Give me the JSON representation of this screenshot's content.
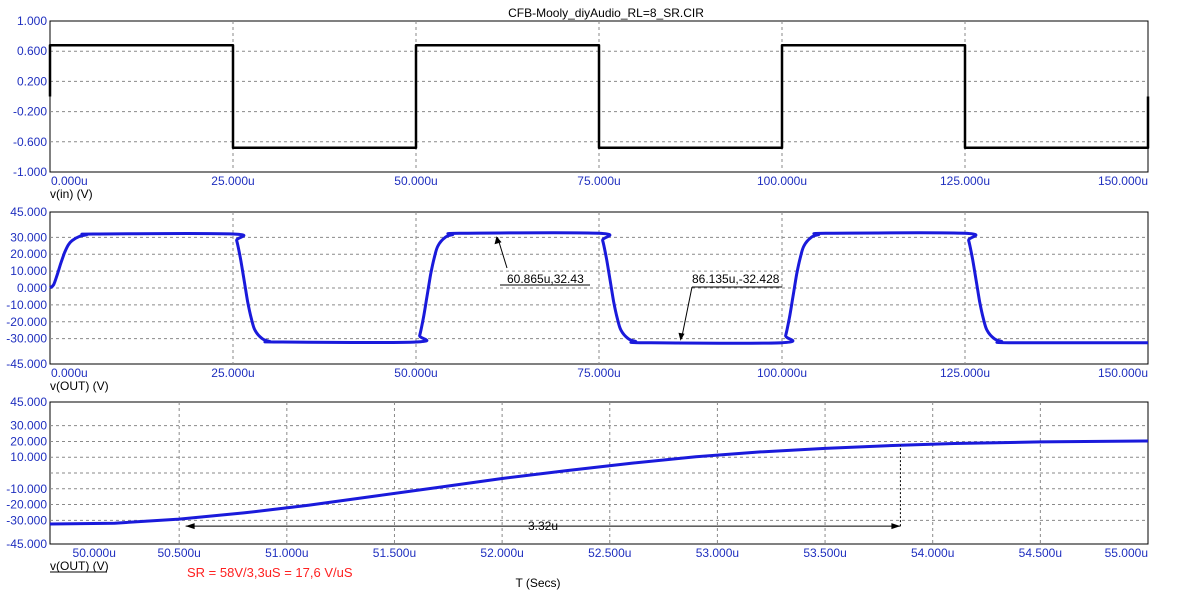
{
  "title": "CFB-Mooly_diyAudio_RL=8_SR.CIR",
  "x_axis_label": "T (Secs)",
  "colors": {
    "axis_text": "#1f2fbf",
    "trace_in": "#000000",
    "trace_out": "#1a1adb",
    "grid": "#8a8a8a",
    "annotation": "#ff2020"
  },
  "chart_data": [
    {
      "type": "line",
      "trace_label": "v(in) (V)",
      "xlim": [
        0,
        150
      ],
      "ylim": [
        -1,
        1
      ],
      "x_ticks": [
        "0.000u",
        "25.000u",
        "50.000u",
        "75.000u",
        "100.000u",
        "125.000u",
        "150.000u"
      ],
      "y_ticks": [
        "1.000",
        "0.600",
        "0.200",
        "-0.200",
        "-0.600",
        "-1.000"
      ],
      "series": [
        {
          "color": "#000000",
          "x": [
            0,
            0,
            25,
            25,
            50,
            50,
            75,
            75,
            100,
            100,
            125,
            125,
            150,
            150
          ],
          "y": [
            0,
            0.68,
            0.68,
            -0.68,
            -0.68,
            0.68,
            0.68,
            -0.68,
            -0.68,
            0.68,
            0.68,
            -0.68,
            -0.68,
            0
          ]
        }
      ]
    },
    {
      "type": "line",
      "trace_label": "v(OUT) (V)",
      "xlim": [
        0,
        150
      ],
      "ylim": [
        -45,
        45
      ],
      "x_ticks": [
        "0.000u",
        "25.000u",
        "50.000u",
        "75.000u",
        "100.000u",
        "125.000u",
        "150.000u"
      ],
      "y_ticks": [
        "45.000",
        "30.000",
        "20.000",
        "10.000",
        "0.000",
        "-10.000",
        "-20.000",
        "-30.000",
        "-45.000"
      ],
      "series": [
        {
          "color": "#1a1adb",
          "x": [
            0,
            0.5,
            1,
            1.5,
            2,
            2.5,
            3,
            4,
            5,
            6,
            25,
            25.5,
            26,
            26.5,
            27,
            27.5,
            28,
            29,
            30,
            31,
            50,
            50.5,
            51,
            51.5,
            52,
            52.5,
            53,
            54,
            55,
            56,
            75,
            75.5,
            76,
            76.5,
            77,
            77.5,
            78,
            79,
            80,
            81,
            100,
            100.5,
            101,
            101.5,
            102,
            102.5,
            103,
            104,
            105,
            106,
            125,
            125.5,
            126,
            126.5,
            127,
            127.5,
            128,
            129,
            130,
            131,
            150
          ],
          "y": [
            0,
            2,
            8,
            15,
            21,
            25.5,
            28,
            30.5,
            31.5,
            32,
            32,
            28,
            18,
            5,
            -8,
            -18,
            -25,
            -30,
            -31.6,
            -32,
            -32,
            -28,
            -18,
            -5,
            8,
            18,
            25,
            30,
            31.6,
            32.4,
            32.4,
            28,
            18,
            5,
            -8,
            -18,
            -25,
            -30,
            -31.6,
            -32.4,
            -32.4,
            -28,
            -18,
            -5,
            8,
            18,
            25,
            30,
            31.6,
            32.4,
            32.4,
            28,
            18,
            5,
            -8,
            -18,
            -25,
            -30,
            -31.6,
            -32.4,
            -32.4
          ]
        }
      ],
      "annotations": [
        {
          "text": "60.865u,32.43",
          "x": 60.865,
          "y": 32.43
        },
        {
          "text": "86.135u,-32.428",
          "x": 86.135,
          "y": -32.428
        }
      ]
    },
    {
      "type": "line",
      "trace_label": "v(OUT) (V)",
      "xlim": [
        49.9,
        55
      ],
      "ylim": [
        -45,
        45
      ],
      "x_ticks": [
        "50.000u",
        "50.500u",
        "51.000u",
        "51.500u",
        "52.000u",
        "52.500u",
        "53.000u",
        "53.500u",
        "54.000u",
        "54.500u",
        "55.000u"
      ],
      "y_ticks": [
        "45.000",
        "30.000",
        "20.000",
        "10.000",
        "-10.000",
        "-20.000",
        "-30.000",
        "-45.000"
      ],
      "series": [
        {
          "color": "#1a1adb",
          "x": [
            49.9,
            50.2,
            50.5,
            50.8,
            51.1,
            51.4,
            51.7,
            52.0,
            52.3,
            52.6,
            52.9,
            53.2,
            53.5,
            53.85,
            54.1,
            54.5,
            55.0
          ],
          "y": [
            -32.3,
            -31.8,
            -29.2,
            -25.3,
            -20.5,
            -14.8,
            -9.2,
            -3.5,
            1.5,
            6.2,
            10.3,
            13.4,
            15.6,
            17.6,
            18.7,
            19.7,
            20.3
          ]
        }
      ],
      "annotations": [
        {
          "text": "3.32u",
          "x_from": 50.53,
          "x_to": 53.85,
          "y": -33
        }
      ],
      "note": "SR = 58V/3,3uS = 17,6 V/uS"
    }
  ]
}
